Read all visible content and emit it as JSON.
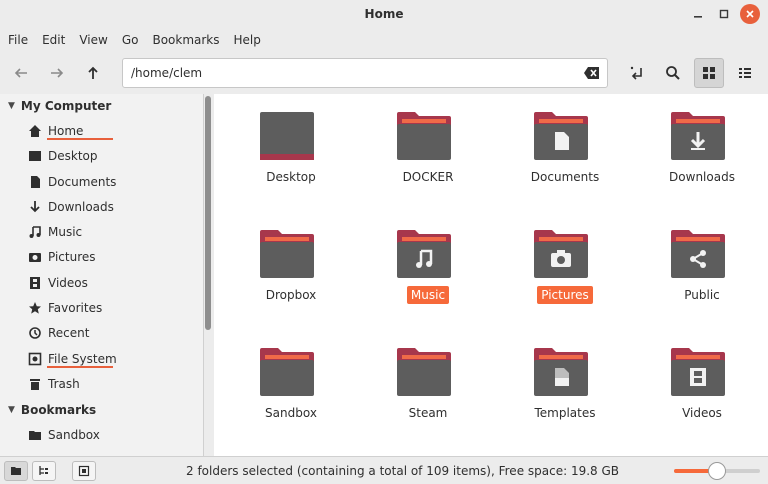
{
  "window": {
    "title": "Home"
  },
  "menu": [
    "File",
    "Edit",
    "View",
    "Go",
    "Bookmarks",
    "Help"
  ],
  "toolbar": {
    "path_value": "/home/clem"
  },
  "sidebar": {
    "sections": [
      {
        "title": "My Computer",
        "items": [
          {
            "label": "Home",
            "icon": "home-icon"
          },
          {
            "label": "Desktop",
            "icon": "desktop-icon"
          },
          {
            "label": "Documents",
            "icon": "document-icon"
          },
          {
            "label": "Downloads",
            "icon": "download-icon"
          },
          {
            "label": "Music",
            "icon": "music-icon"
          },
          {
            "label": "Pictures",
            "icon": "camera-icon"
          },
          {
            "label": "Videos",
            "icon": "film-icon"
          },
          {
            "label": "Favorites",
            "icon": "star-icon"
          },
          {
            "label": "Recent",
            "icon": "recent-icon"
          },
          {
            "label": "File System",
            "icon": "drive-icon"
          },
          {
            "label": "Trash",
            "icon": "trash-icon"
          }
        ]
      },
      {
        "title": "Bookmarks",
        "items": [
          {
            "label": "Sandbox",
            "icon": "folder-icon"
          }
        ]
      }
    ]
  },
  "files": [
    {
      "name": "Desktop",
      "emblem": "desktop",
      "selected": false
    },
    {
      "name": "DOCKER",
      "emblem": "none",
      "selected": false
    },
    {
      "name": "Documents",
      "emblem": "document",
      "selected": false
    },
    {
      "name": "Downloads",
      "emblem": "download",
      "selected": false
    },
    {
      "name": "Dropbox",
      "emblem": "none",
      "selected": false
    },
    {
      "name": "Music",
      "emblem": "music",
      "selected": true
    },
    {
      "name": "Pictures",
      "emblem": "camera",
      "selected": true
    },
    {
      "name": "Public",
      "emblem": "share",
      "selected": false
    },
    {
      "name": "Sandbox",
      "emblem": "none",
      "selected": false
    },
    {
      "name": "Steam",
      "emblem": "none",
      "selected": false
    },
    {
      "name": "Templates",
      "emblem": "template",
      "selected": false
    },
    {
      "name": "Videos",
      "emblem": "film",
      "selected": false
    }
  ],
  "status": {
    "text": "2 folders selected (containing a total of 109 items), Free space: 19.8 GB",
    "zoom_fraction": 0.5
  },
  "colors": {
    "accent": "#f6693a",
    "folder_tab": "#a7374c",
    "folder_body": "#5d5d5d",
    "folder_strip": "#f06a48",
    "close": "#e8603c"
  }
}
